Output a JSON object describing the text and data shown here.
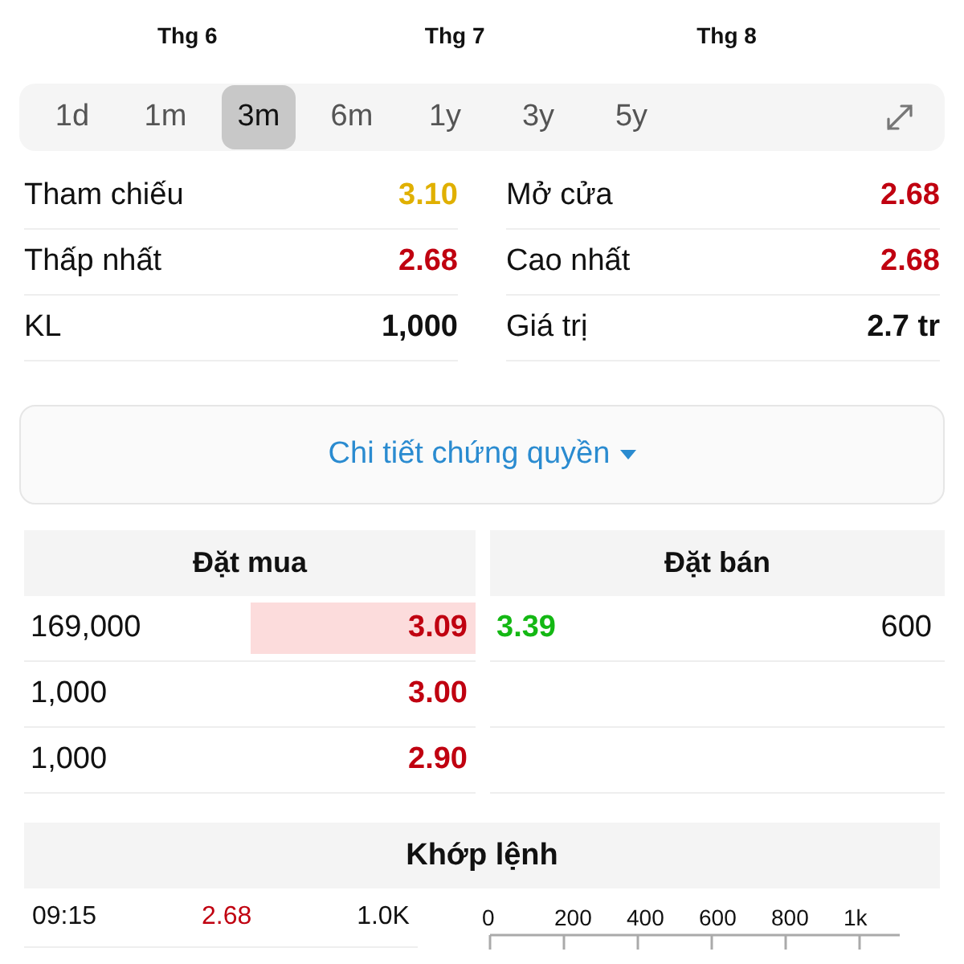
{
  "chart_months": [
    "Thg 6",
    "Thg 7",
    "Thg 8"
  ],
  "periods": [
    {
      "label": "1d",
      "selected": false
    },
    {
      "label": "1m",
      "selected": false
    },
    {
      "label": "3m",
      "selected": true
    },
    {
      "label": "6m",
      "selected": false
    },
    {
      "label": "1y",
      "selected": false
    },
    {
      "label": "3y",
      "selected": false
    },
    {
      "label": "5y",
      "selected": false
    }
  ],
  "stats": [
    {
      "label": "Tham chiếu",
      "value": "3.10",
      "color": "#e0b000"
    },
    {
      "label": "Mở cửa",
      "value": "2.68",
      "color": "#c00010"
    },
    {
      "label": "Thấp nhất",
      "value": "2.68",
      "color": "#c00010"
    },
    {
      "label": "Cao nhất",
      "value": "2.68",
      "color": "#c00010"
    },
    {
      "label": "KL",
      "value": "1,000",
      "color": "#111111"
    },
    {
      "label": "Giá trị",
      "value": "2.7 tr",
      "color": "#111111"
    }
  ],
  "detail_button": "Chi tiết chứng quyền",
  "order_book": {
    "buy_title": "Đặt mua",
    "sell_title": "Đặt bán",
    "buy": [
      {
        "volume": "169,000",
        "price": "3.09",
        "color": "#c00010",
        "highlighted": true
      },
      {
        "volume": "1,000",
        "price": "3.00",
        "color": "#c00010",
        "highlighted": false
      },
      {
        "volume": "1,000",
        "price": "2.90",
        "color": "#c00010",
        "highlighted": false
      }
    ],
    "sell": [
      {
        "price": "3.39",
        "volume": "600",
        "color": "#14b814"
      }
    ]
  },
  "matches": {
    "title": "Khớp lệnh",
    "rows": [
      {
        "time": "09:15",
        "price": "2.68",
        "color": "#c00010",
        "volume": "1.0K"
      }
    ],
    "axis_ticks": [
      "0",
      "200",
      "400",
      "600",
      "800",
      "1k"
    ]
  }
}
